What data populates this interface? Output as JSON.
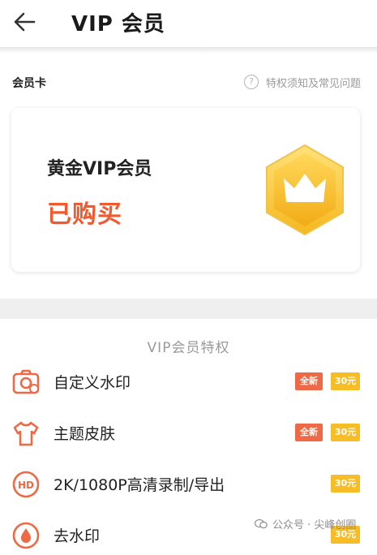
{
  "header": {
    "title": "VIP 会员"
  },
  "section": {
    "title": "会员卡",
    "faq_label": "特权须知及常见问题"
  },
  "card": {
    "tier": "黄金VIP会员",
    "status": "已购买"
  },
  "privileges": {
    "title": "VIP会员特权",
    "items": [
      {
        "label": "自定义水印",
        "icon": "camera-watermark-icon",
        "new_tag": "全新",
        "price_tag": "30元"
      },
      {
        "label": "主题皮肤",
        "icon": "shirt-icon",
        "new_tag": "全新",
        "price_tag": "30元"
      },
      {
        "label": "2K/1080P高清录制/导出",
        "icon": "hd-icon",
        "icon_text": "HD",
        "price_tag": "30元"
      },
      {
        "label": "去水印",
        "icon": "drop-icon",
        "price_tag": "30元"
      }
    ]
  },
  "watermark": {
    "text": "公众号 · 尖峰创圈"
  },
  "colors": {
    "accent": "#ef5a2f",
    "gold": "#f6bd26",
    "new_tag": "#ee6a47"
  }
}
